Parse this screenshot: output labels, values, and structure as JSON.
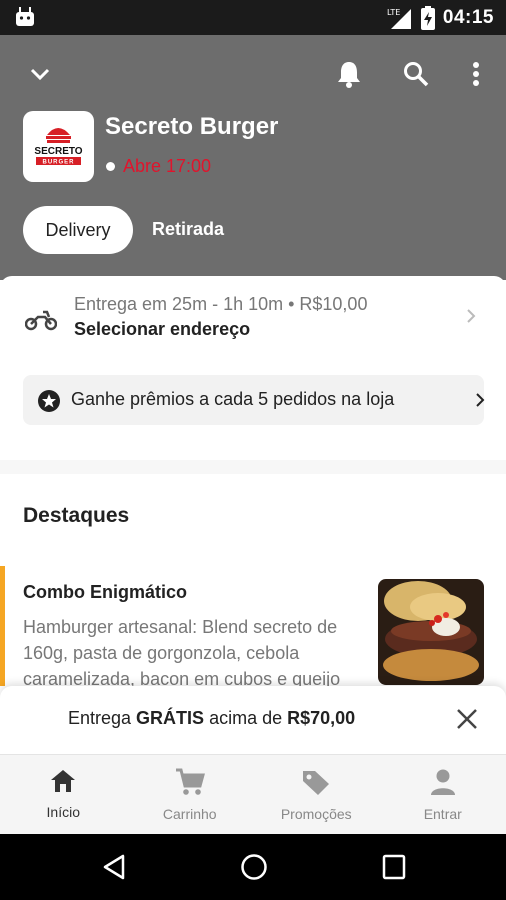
{
  "status_bar": {
    "time": "04:15",
    "network": "LTE"
  },
  "header": {
    "store_name": "Secreto Burger",
    "store_status": "Abre 17:00",
    "logo_text_top": "SECRETO",
    "logo_text_bottom": "BURGER",
    "tabs": [
      {
        "label": "Delivery",
        "selected": true
      },
      {
        "label": "Retirada",
        "selected": false
      }
    ],
    "icons": [
      "chevron-down-icon",
      "bell-icon",
      "search-icon",
      "more-vert-icon"
    ]
  },
  "delivery": {
    "info": "Entrega em 25m - 1h 10m • R$10,00",
    "address_action": "Selecionar endereço"
  },
  "rewards": {
    "label": "Ganhe prêmios a cada 5 pedidos na loja"
  },
  "highlights": {
    "title": "Destaques",
    "items": [
      {
        "name": "Combo Enigmático",
        "description": "Hamburger artesanal: Blend secreto de 160g, pasta de gorgonzola, cebola caramelizada, bacon em cubos e queijo"
      }
    ]
  },
  "banner": {
    "prefix": "Entrega ",
    "emphasis1": "GRÁTIS",
    "middle": " acima de ",
    "emphasis2": "R$70,00"
  },
  "bottom_nav": [
    {
      "label": "Início",
      "icon": "home-icon",
      "active": true
    },
    {
      "label": "Carrinho",
      "icon": "cart-icon",
      "active": false
    },
    {
      "label": "Promoções",
      "icon": "tag-icon",
      "active": false
    },
    {
      "label": "Entrar",
      "icon": "person-icon",
      "active": false
    }
  ],
  "colors": {
    "header_bg": "#6d6d6d",
    "status_closed": "#e0142c",
    "highlight_bar": "#f5a623"
  }
}
